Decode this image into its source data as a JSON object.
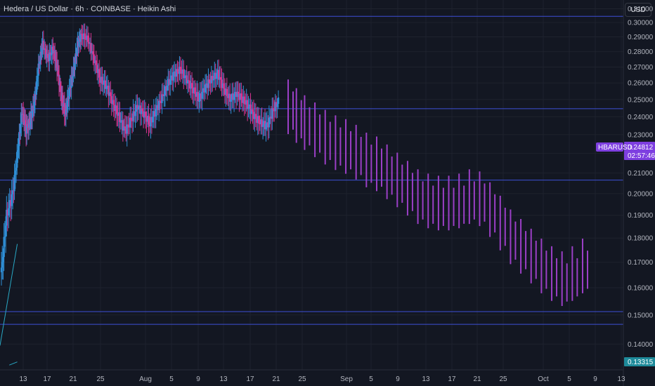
{
  "header": {
    "title": "Hedera / US Dollar · 6h · COINBASE · Heikin Ashi",
    "currency_button": "USD"
  },
  "price_tag": {
    "symbol": "HBARUSD",
    "price": "0.24812",
    "countdown": "02:57:46",
    "color": "#7e3fe0"
  },
  "low_tag": {
    "value": "0.13315",
    "color": "#1e8a9a"
  },
  "colors": {
    "background": "#131722",
    "up": "#2f8fd6",
    "down": "#d6338f",
    "forecast": "#9b3fc6",
    "hline": "#3d4fd6",
    "trend": "#29a8c4",
    "grid": "#1e222d"
  },
  "chart_data": {
    "type": "candlestick",
    "style": "Heikin Ashi",
    "interval": "6h",
    "exchange": "COINBASE",
    "symbol": "HBARUSD",
    "y_scale": "log",
    "ylim": [
      0.1317,
      0.3165
    ],
    "y_ticks": [
      "0.31000",
      "0.30000",
      "0.29000",
      "0.28000",
      "0.27000",
      "0.26000",
      "0.25000",
      "0.24000",
      "0.23000",
      "0.22000",
      "0.21000",
      "0.20000",
      "0.19000",
      "0.18000",
      "0.17000",
      "0.16000",
      "0.15000",
      "0.14000"
    ],
    "x_ticks": [
      "13",
      "17",
      "21",
      "25",
      "Aug",
      "5",
      "9",
      "13",
      "17",
      "21",
      "25",
      "Sep",
      "5",
      "9",
      "13",
      "17",
      "21",
      "25",
      "Oct",
      "5",
      "9",
      "13"
    ],
    "x_range_days": [
      10.3,
      13.1
    ],
    "horizontal_lines": [
      0.3045,
      0.2446,
      0.2065,
      0.1512,
      0.1467
    ],
    "trend_lines": [
      {
        "from": [
          10.3,
          0.1395
        ],
        "to": [
          12.9,
          0.1775
        ]
      },
      {
        "from": [
          11.7,
          0.1332
        ],
        "to": [
          12.9,
          0.1342
        ]
      }
    ],
    "series": [
      {
        "name": "history",
        "points": [
          [
            10.3,
            0.166
          ],
          [
            10.55,
            0.19
          ],
          [
            10.85,
            0.2
          ],
          [
            11.1,
            0.222
          ],
          [
            11.3,
            0.243
          ],
          [
            11.5,
            0.233
          ],
          [
            11.7,
            0.238
          ],
          [
            11.9,
            0.248
          ],
          [
            12.1,
            0.27
          ],
          [
            12.3,
            0.285
          ],
          [
            12.55,
            0.275
          ],
          [
            12.8,
            0.282
          ],
          [
            13.0,
            0.27
          ],
          [
            13.2,
            0.252
          ],
          [
            13.4,
            0.242
          ],
          [
            13.6,
            0.255
          ],
          [
            13.8,
            0.268
          ],
          [
            14.0,
            0.285
          ],
          [
            14.2,
            0.291
          ],
          [
            14.5,
            0.288
          ],
          [
            14.8,
            0.275
          ],
          [
            15.1,
            0.262
          ],
          [
            15.4,
            0.258
          ],
          [
            15.7,
            0.248
          ],
          [
            16.0,
            0.24
          ],
          [
            16.3,
            0.232
          ],
          [
            16.6,
            0.238
          ],
          [
            16.9,
            0.246
          ],
          [
            17.2,
            0.242
          ],
          [
            17.5,
            0.236
          ],
          [
            17.8,
            0.244
          ],
          [
            18.1,
            0.251
          ],
          [
            18.4,
            0.26
          ],
          [
            18.7,
            0.266
          ],
          [
            19.0,
            0.268
          ],
          [
            19.3,
            0.262
          ],
          [
            19.6,
            0.256
          ],
          [
            19.9,
            0.25
          ],
          [
            20.2,
            0.258
          ],
          [
            20.5,
            0.262
          ],
          [
            20.8,
            0.266
          ],
          [
            21.1,
            0.256
          ],
          [
            21.4,
            0.25
          ],
          [
            21.7,
            0.254
          ],
          [
            22.0,
            0.25
          ],
          [
            22.3,
            0.246
          ],
          [
            22.6,
            0.24
          ],
          [
            22.9,
            0.236
          ],
          [
            23.2,
            0.235
          ],
          [
            23.5,
            0.244
          ],
          [
            23.8,
            0.25
          ]
        ]
      },
      {
        "name": "projection",
        "points": [
          [
            24.2,
            0.245
          ],
          [
            24.6,
            0.24
          ],
          [
            25.0,
            0.236
          ],
          [
            25.5,
            0.232
          ],
          [
            26.0,
            0.228
          ],
          [
            26.5,
            0.225
          ],
          [
            27.0,
            0.223
          ],
          [
            27.5,
            0.22
          ],
          [
            28.0,
            0.216
          ],
          [
            28.5,
            0.214
          ],
          [
            29.0,
            0.21
          ],
          [
            29.5,
            0.206
          ],
          [
            30.0,
            0.202
          ],
          [
            30.5,
            0.198
          ],
          [
            31.0,
            0.196
          ],
          [
            31.5,
            0.195
          ],
          [
            32.0,
            0.195
          ],
          [
            32.5,
            0.196
          ],
          [
            33.0,
            0.198
          ],
          [
            33.5,
            0.197
          ],
          [
            34.0,
            0.192
          ],
          [
            34.5,
            0.186
          ],
          [
            35.0,
            0.18
          ],
          [
            35.5,
            0.176
          ],
          [
            36.0,
            0.172
          ],
          [
            36.5,
            0.168
          ],
          [
            37.0,
            0.165
          ],
          [
            37.5,
            0.163
          ],
          [
            38.0,
            0.165
          ],
          [
            38.5,
            0.168
          ]
        ]
      }
    ]
  }
}
